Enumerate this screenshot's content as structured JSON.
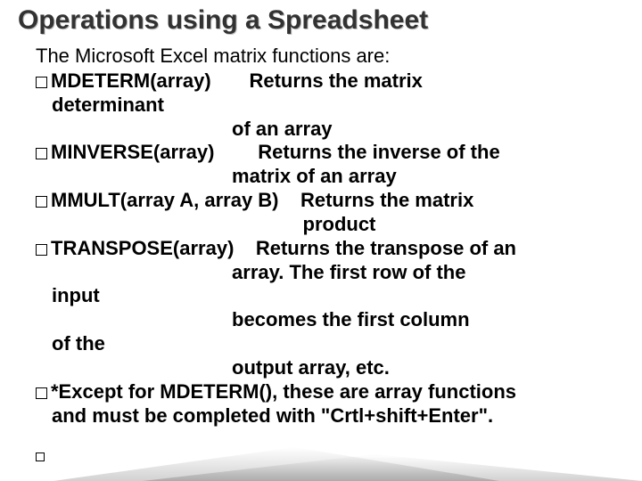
{
  "title": "Operations using a Spreadsheet",
  "intro": "The Microsoft Excel matrix functions are:",
  "lines": {
    "l1a": "MDETERM(array)       Returns the matrix",
    "l1b": "determinant",
    "l1c": "                                    of an array",
    "l2a": "MINVERSE(array)        Returns the inverse of the",
    "l2b": "                                    matrix of an array",
    "l3a": "MMULT(array A, array B)    Returns the matrix",
    "l3b": "                                                 product",
    "l4a": "TRANSPOSE(array)    Returns the transpose of an",
    "l4b": "                                    array. The first row of the",
    "l4c": "input",
    "l4d": "                                    becomes the first column",
    "l4e": "of the",
    "l4f": "                                    output array, etc.",
    "l5a": "*Except for MDETERM(), these are array functions",
    "l5b": "and must be completed with \"Crtl+shift+Enter\"."
  }
}
